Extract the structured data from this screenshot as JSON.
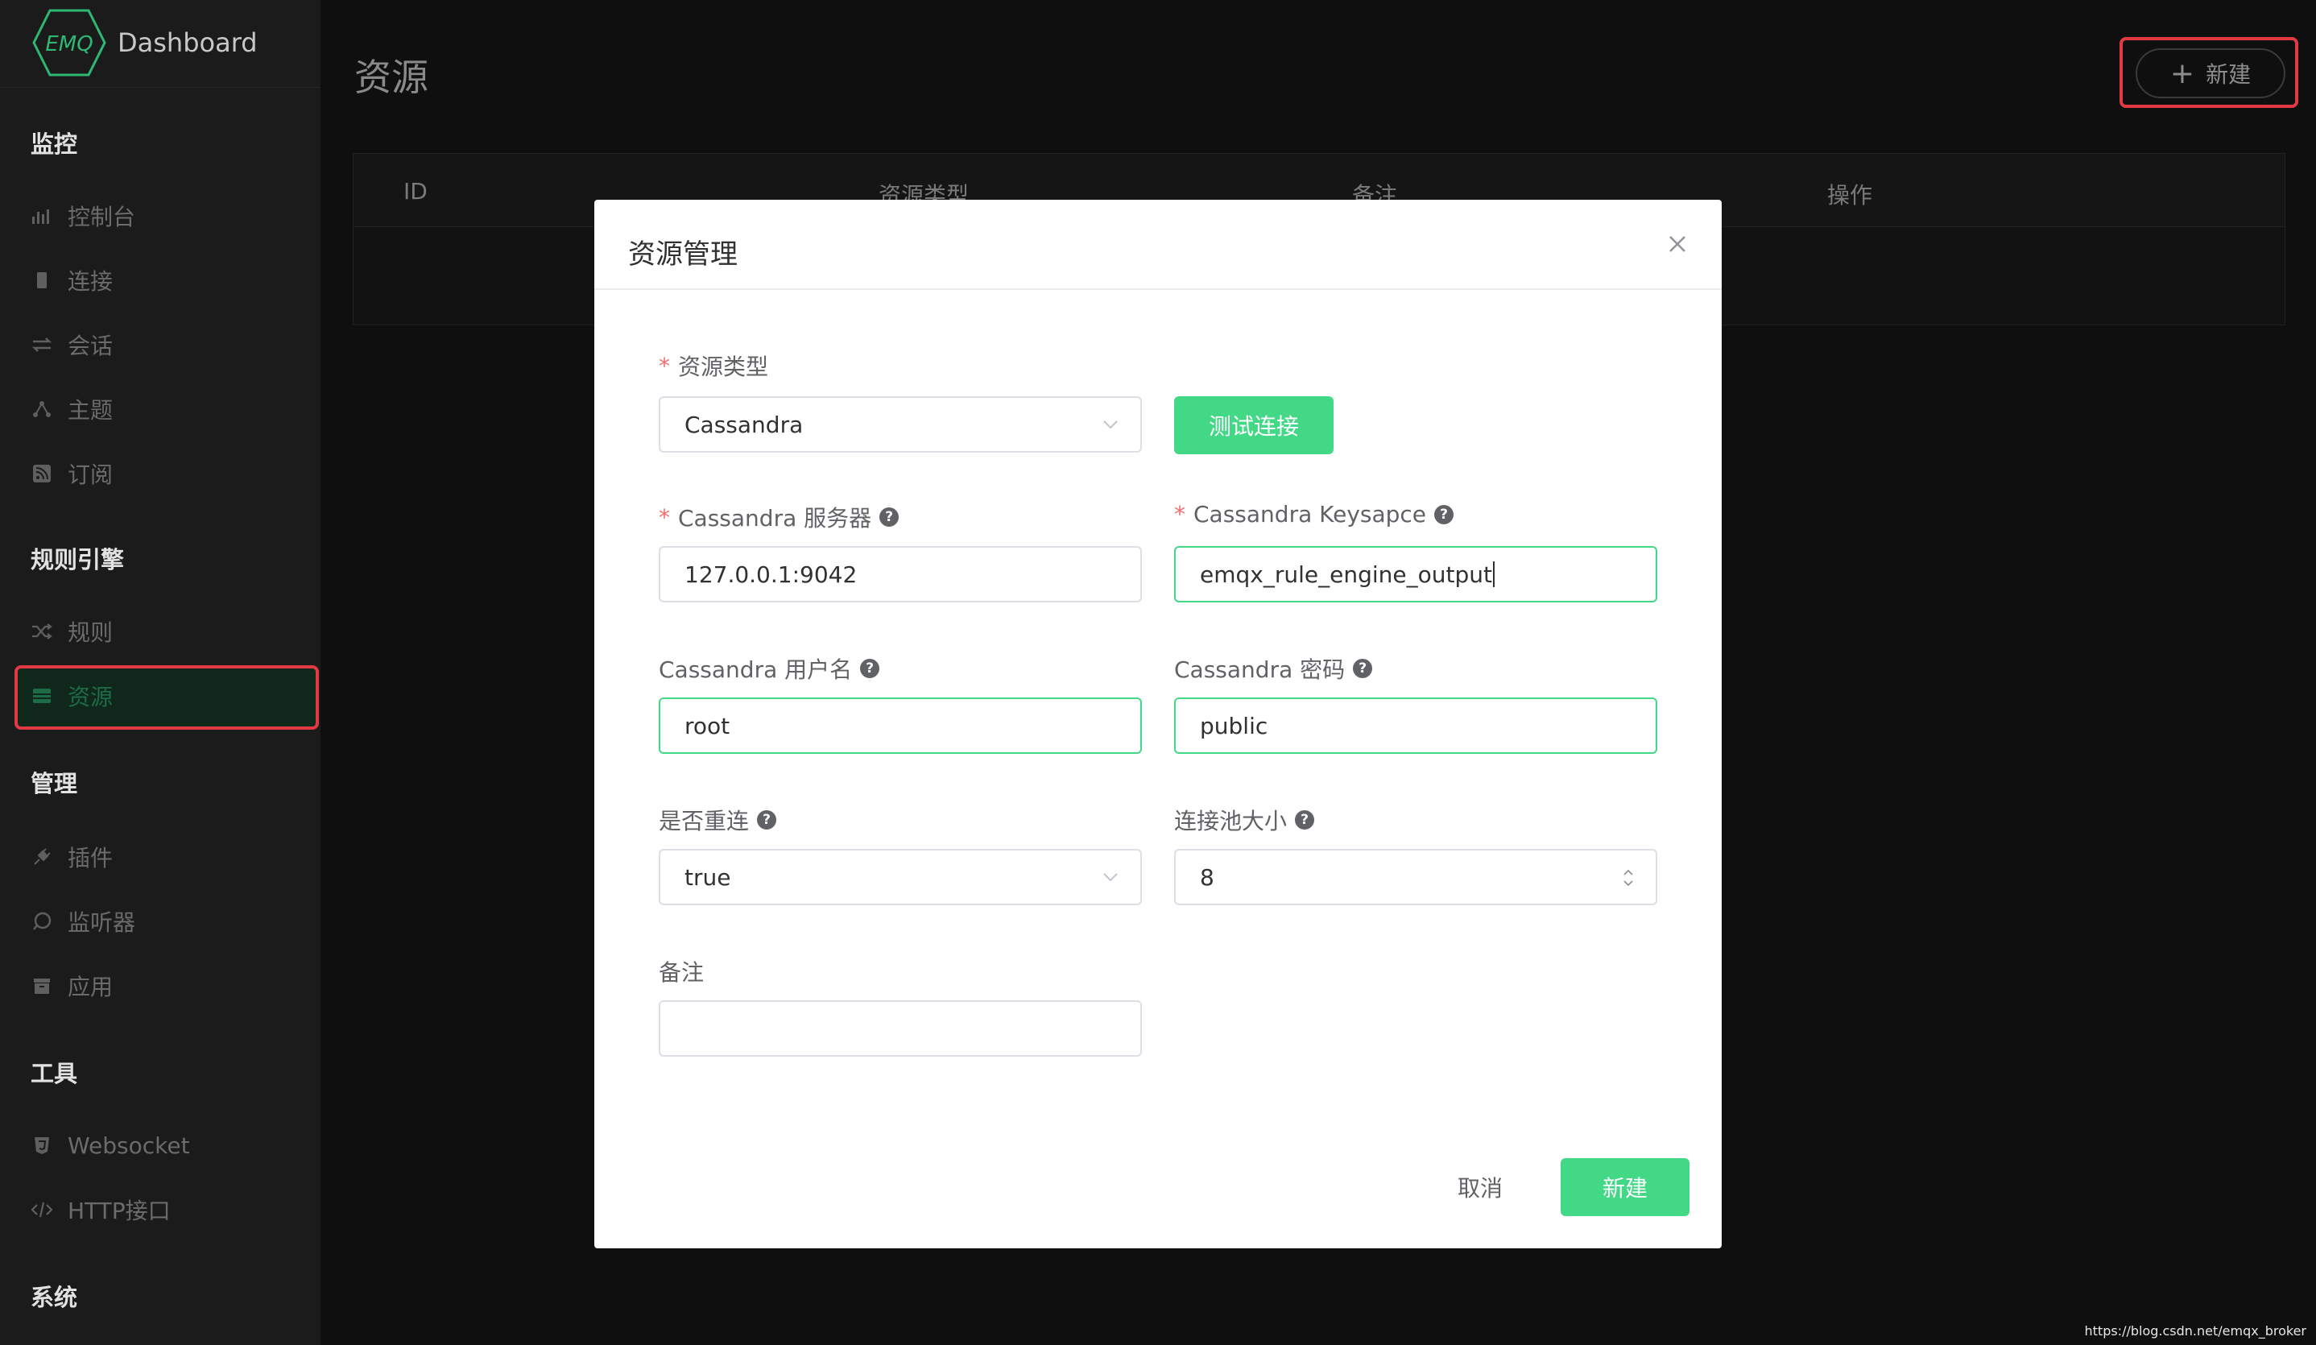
{
  "app": {
    "logo_text": "EMQ",
    "title": "Dashboard"
  },
  "sidebar": {
    "sections": {
      "monitor": "监控",
      "rule_engine": "规则引擎",
      "manage": "管理",
      "tools": "工具",
      "system": "系统"
    },
    "items": {
      "console": "控制台",
      "connections": "连接",
      "sessions": "会话",
      "topics": "主题",
      "subscriptions": "订阅",
      "rules": "规则",
      "resources": "资源",
      "plugins": "插件",
      "listeners": "监听器",
      "applications": "应用",
      "websocket": "Websocket",
      "http_api": "HTTP接口"
    },
    "active_item": "resources"
  },
  "page": {
    "title": "资源",
    "new_button": "新建",
    "table": {
      "columns": [
        "ID",
        "资源类型",
        "备注",
        "操作"
      ]
    }
  },
  "modal": {
    "title": "资源管理",
    "fields": {
      "resource_type": {
        "label": "资源类型",
        "required": true,
        "value": "Cassandra"
      },
      "test_button": "测试连接",
      "server": {
        "label": "Cassandra 服务器",
        "required": true,
        "value": "127.0.0.1:9042"
      },
      "keyspace": {
        "label": "Cassandra Keysapce",
        "required": true,
        "value": "emqx_rule_engine_output"
      },
      "username": {
        "label": "Cassandra 用户名",
        "value": "root"
      },
      "password": {
        "label": "Cassandra 密码",
        "value": "public"
      },
      "auto_reconnect": {
        "label": "是否重连",
        "value": "true"
      },
      "pool_size": {
        "label": "连接池大小",
        "value": "8"
      },
      "remark": {
        "label": "备注",
        "value": ""
      }
    },
    "cancel_button": "取消",
    "submit_button": "新建"
  },
  "colors": {
    "accent": "#42d885",
    "highlight": "#e13a44",
    "required": "#f56c6c"
  },
  "watermark": "https://blog.csdn.net/emqx_broker"
}
